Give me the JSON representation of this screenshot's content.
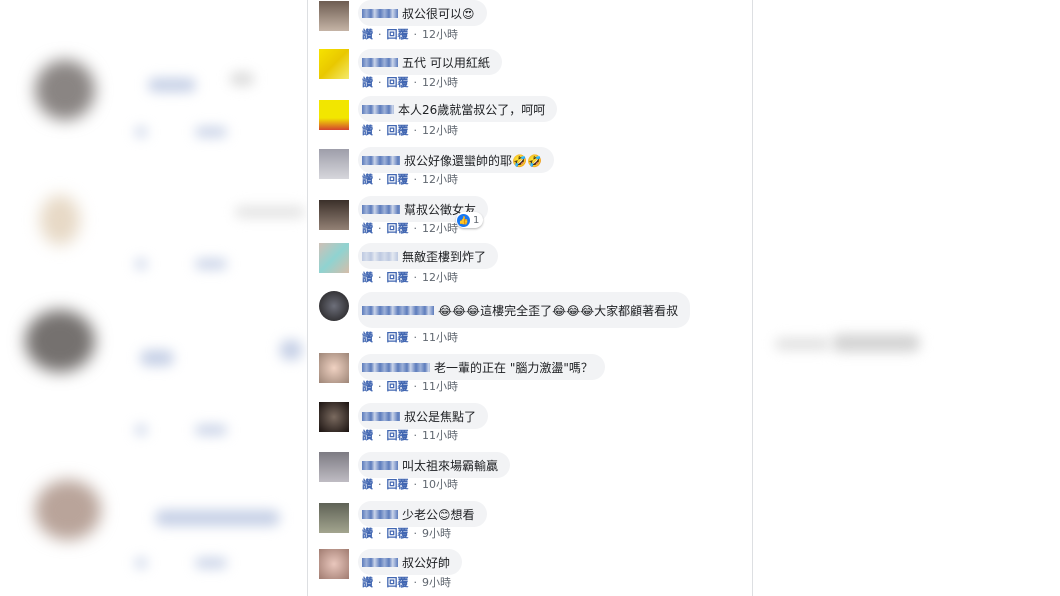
{
  "actions": {
    "like": "讚",
    "reply": "回覆"
  },
  "comments": [
    {
      "text": "叔公很可以😍",
      "time": "12小時"
    },
    {
      "text": "五代 可以用紅紙",
      "time": "12小時"
    },
    {
      "text": "本人26歲就當叔公了，呵呵",
      "time": "12小時"
    },
    {
      "text": "叔公好像還蠻帥的耶🤣🤣",
      "time": "12小時"
    },
    {
      "text": "幫叔公徵女友",
      "time": "12小時",
      "reaction_count": "1"
    },
    {
      "text": "無敵歪樓到炸了",
      "time": "12小時"
    },
    {
      "text": "😂😂😂這樓完全歪了😂😂😂大家都顧著看叔",
      "time": "11小時"
    },
    {
      "text": "老一輩的正在 \"腦力激盪\"嗎？",
      "time": "11小時"
    },
    {
      "text": "叔公是焦點了",
      "time": "11小時"
    },
    {
      "text": "叫太祖來場霸輸贏",
      "time": "10小時"
    },
    {
      "text": "少老公😊想看",
      "time": "9小時"
    },
    {
      "text": "叔公好帥",
      "time": "9小時"
    }
  ],
  "colors": {
    "link": "#4267b2",
    "bubble": "#f2f3f5",
    "like": "#1877f2"
  },
  "icons": {
    "reaction": "like-thumb-icon"
  }
}
